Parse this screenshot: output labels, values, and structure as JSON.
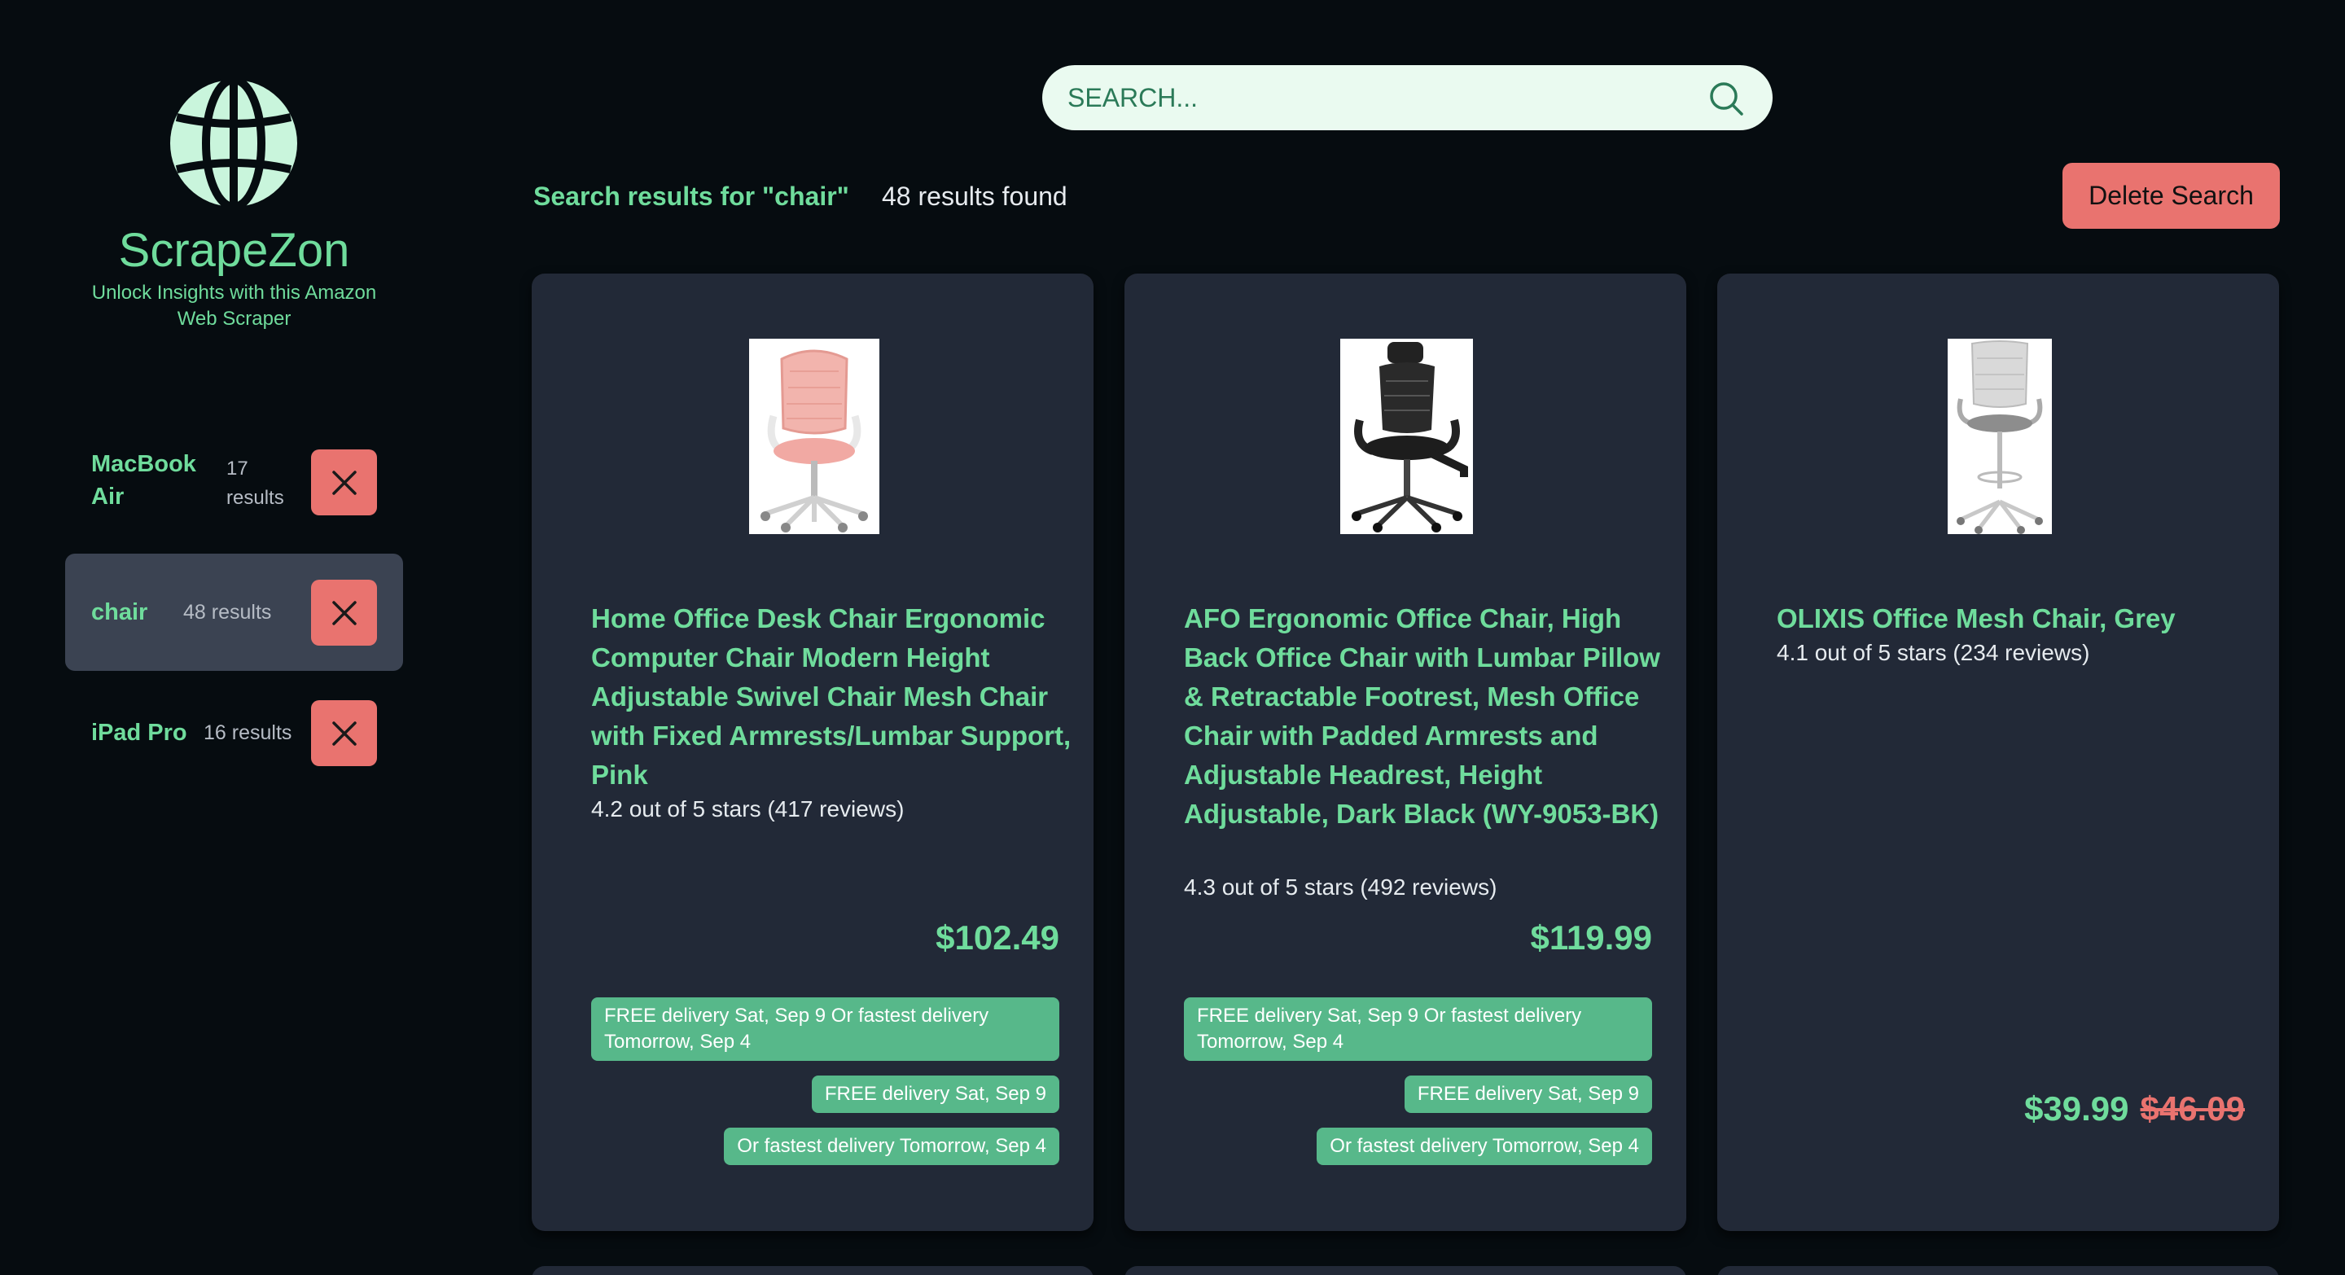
{
  "brand": {
    "title": "ScrapeZon",
    "tagline": "Unlock Insights with this Amazon Web Scraper",
    "accent": "#6fdc9c"
  },
  "history": [
    {
      "name": "MacBook Air",
      "count": "17 results",
      "active": false
    },
    {
      "name": "chair",
      "count": "48 results",
      "active": true
    },
    {
      "name": "iPad Pro",
      "count": "16 results",
      "active": false
    }
  ],
  "search": {
    "placeholder": "SEARCH...",
    "value": ""
  },
  "results": {
    "heading": "Search results for \"chair\"",
    "count": "48 results found",
    "delete_label": "Delete Search"
  },
  "products": [
    {
      "title": "Home Office Desk Chair Ergonomic Computer Chair Modern Height Adjustable Swivel Chair Mesh Chair with Fixed Armrests/Lumbar Support, Pink",
      "rating": "4.2 out of 5 stars (417 reviews)",
      "price": "$102.49",
      "delivery_full": "FREE delivery Sat, Sep 9 Or fastest delivery Tomorrow, Sep 4",
      "delivery_free": "FREE delivery Sat, Sep 9",
      "delivery_fast": "Or fastest delivery Tomorrow, Sep 4"
    },
    {
      "title": "AFO Ergonomic Office Chair, High Back Office Chair with Lumbar Pillow & Retractable Footrest, Mesh Office Chair with Padded Armrests and Adjustable Headrest, Height Adjustable, Dark Black (WY-9053-BK)",
      "rating": "4.3 out of 5 stars (492 reviews)",
      "price": "$119.99",
      "delivery_full": "FREE delivery Sat, Sep 9 Or fastest delivery Tomorrow, Sep 4",
      "delivery_free": "FREE delivery Sat, Sep 9",
      "delivery_fast": "Or fastest delivery Tomorrow, Sep 4"
    },
    {
      "title": "OLIXIS Office Mesh Chair, Grey",
      "rating": "4.1 out of 5 stars (234 reviews)",
      "price": "$39.99",
      "old_price": "$46.09"
    }
  ]
}
